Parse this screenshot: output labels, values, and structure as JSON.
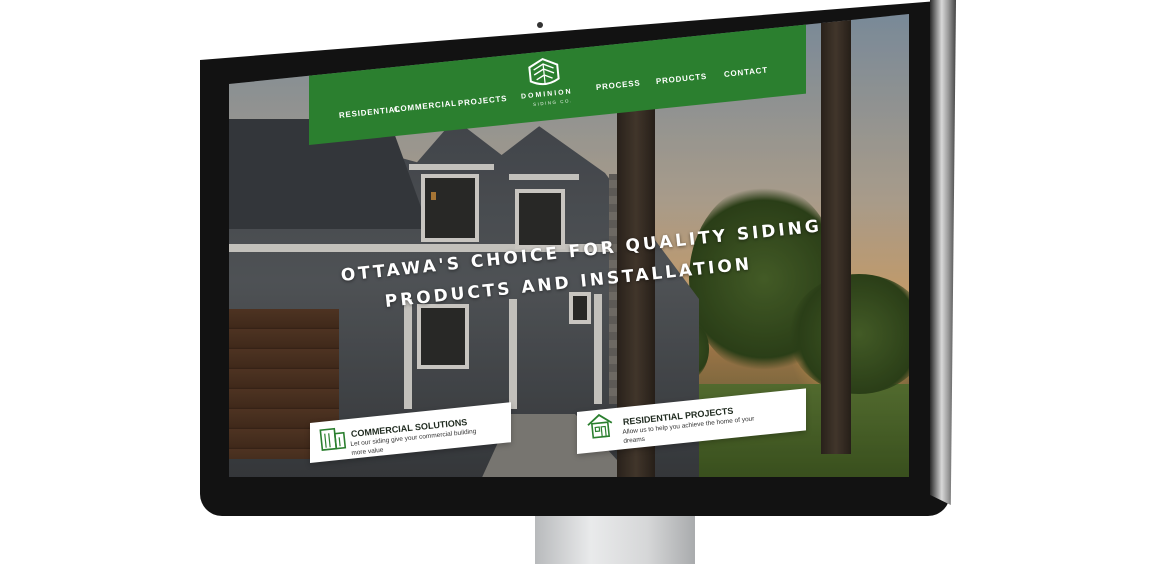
{
  "brand": {
    "name": "DOMINION",
    "sub": "SIDING CO.",
    "color": "#2b7f2f"
  },
  "nav": {
    "residential": "RESIDENTIAL",
    "commercial": "COMMERCIAL",
    "projects": "PROJECTS",
    "process": "PROCESS",
    "products": "PRODUCTS",
    "contact": "CONTACT"
  },
  "hero": {
    "line1": "OTTAWA'S CHOICE FOR QUALITY SIDING",
    "line2": "PRODUCTS AND INSTALLATION"
  },
  "cards": {
    "commercial": {
      "title": "COMMERCIAL SOLUTIONS",
      "desc": "Let our siding give your commercial building more value",
      "icon": "building-icon"
    },
    "residential": {
      "title": "RESIDENTIAL PROJECTS",
      "desc": "Allow us to help you achieve the home of your dreams",
      "icon": "house-icon"
    }
  }
}
